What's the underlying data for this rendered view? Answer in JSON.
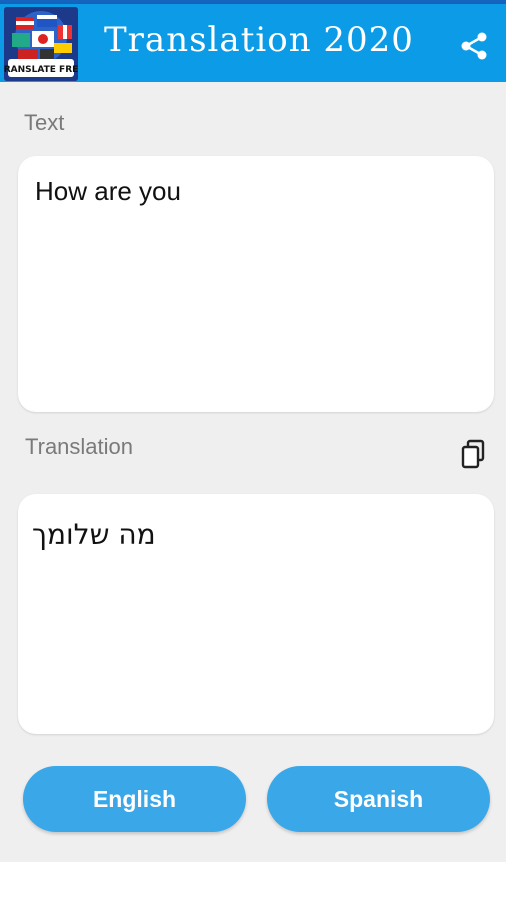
{
  "app_bar": {
    "title": "Translation 2020",
    "logo_text": "TRANSLATE FREE",
    "share_icon": "share-icon",
    "background": "#0c9be6"
  },
  "input": {
    "label": "Text",
    "value": "How are you"
  },
  "output": {
    "label": "Translation",
    "value": "מה שלומך",
    "copy_icon": "copy-icon"
  },
  "languages": {
    "source": "English",
    "target": "Spanish",
    "button_color": "#3aa8e8"
  }
}
